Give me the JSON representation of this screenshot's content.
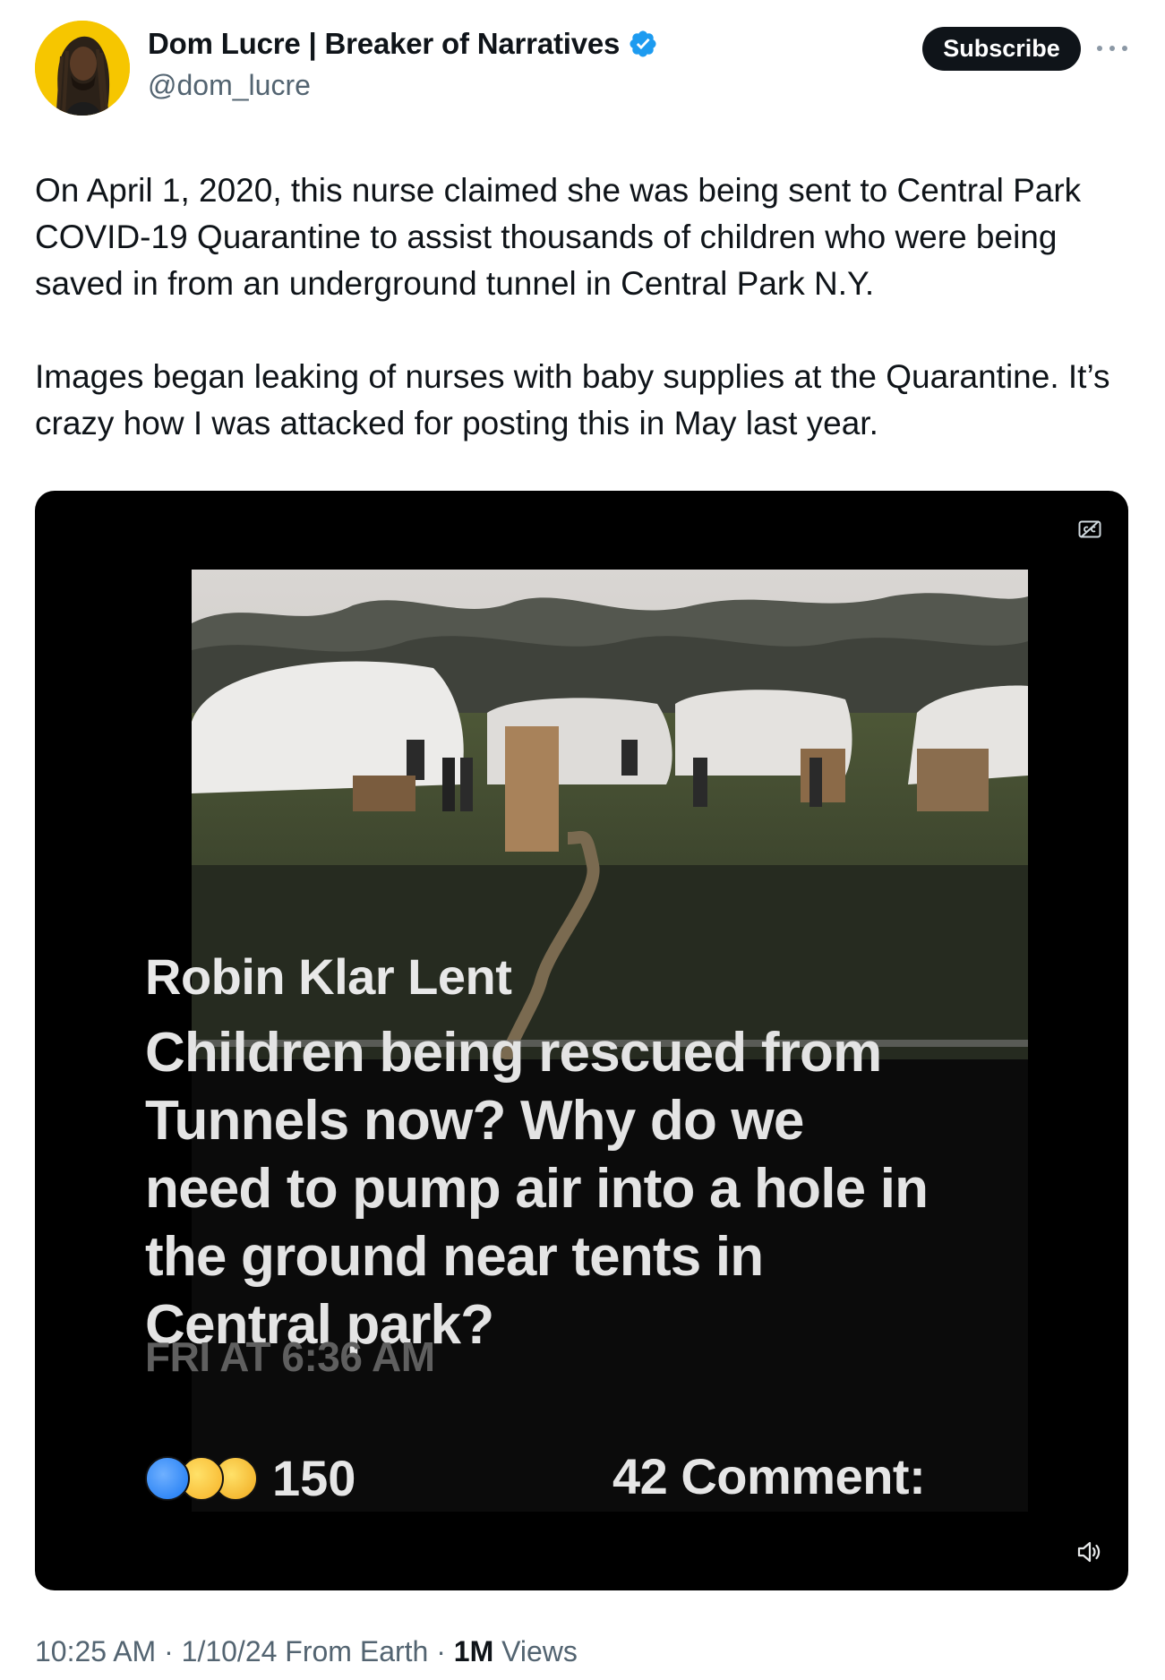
{
  "author": {
    "display_name": "Dom Lucre | Breaker of Narratives",
    "handle": "@dom_lucre",
    "verified": true
  },
  "actions": {
    "subscribe_label": "Subscribe"
  },
  "tweet": {
    "paragraphs": [
      "On April 1, 2020, this nurse claimed she was being sent to Central Park COVID-19 Quarantine to assist thousands of children who were being saved in from an underground tunnel in Central Park N.Y.",
      "Images began leaking of nurses with baby supplies at the Quarantine. It’s crazy how I was attacked for posting this in May last year."
    ]
  },
  "video": {
    "overlay_name": "Robin Klar Lent",
    "overlay_text": "Children being rescued from Tunnels now? Why do we need to pump air into a hole in the ground near tents in Central park?",
    "overlay_time": "FRI AT 6:36 AM",
    "reaction_count": "150",
    "comments": "42 Comment:"
  },
  "meta": {
    "time": "10:25 AM",
    "date": "1/10/24",
    "source": "From Earth",
    "views_count": "1M",
    "views_label": "Views",
    "separator": "·"
  },
  "colors": {
    "text_primary": "#0f1419",
    "text_secondary": "#536471",
    "verified_blue": "#1d9bf0",
    "avatar_bg": "#f6c600"
  },
  "icons": [
    "verified-badge-icon",
    "more-options-icon",
    "captions-icon",
    "volume-icon"
  ]
}
